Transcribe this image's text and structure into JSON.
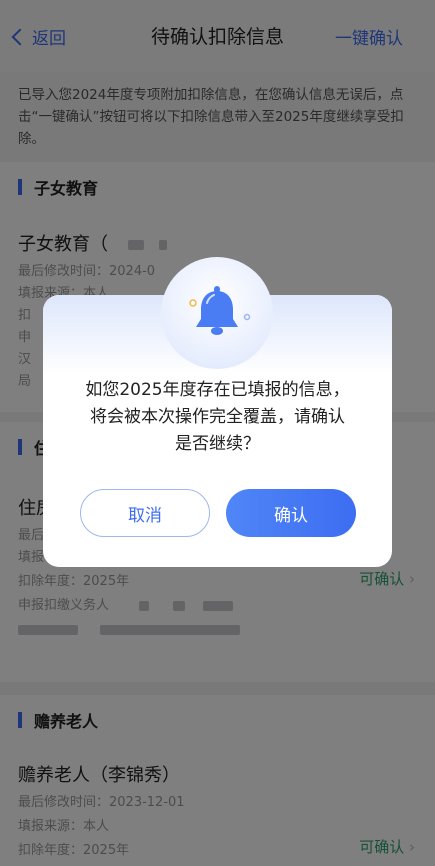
{
  "nav": {
    "back_label": "返回",
    "title": "待确认扣除信息",
    "action_label": "一键确认"
  },
  "notice": {
    "text": "已导入您2024年度专项附加扣除信息，在您确认信息无误后，点击“一键确认”按钮可将以下扣除信息带入至2025年度继续享受扣除。"
  },
  "sections": {
    "child_education": {
      "header": "子女教育",
      "card_title": "子女教育（",
      "modified_label": "最后修改时间：2024-0",
      "source_label": "填报来源：本人",
      "line3": "扣",
      "line4": "申",
      "line5": "汉",
      "line6": "局"
    },
    "housing": {
      "header": "住",
      "card_title": "住房",
      "line1": "最后",
      "line2": "填报",
      "year_label": "扣除年度：2025年",
      "reporter_label": "申报扣缴义务人",
      "status": "可确认"
    },
    "elderly": {
      "header": "赡养老人",
      "card_title": "赡养老人（李锦秀）",
      "modified_label": "最后修改时间：2023-12-01",
      "source_label": "填报来源：本人",
      "year_label": "扣除年度：2025年",
      "status": "可确认"
    }
  },
  "dialog": {
    "message_lines": [
      "如您2025年度存在已填报的信息，",
      "将会被本次操作完全覆盖，请确认",
      "是否继续？"
    ],
    "cancel_label": "取消",
    "confirm_label": "确认"
  },
  "colors": {
    "accent": "#3d6df2",
    "status_green": "#2fa36b",
    "overlay": "rgba(0,0,0,0.5)"
  }
}
